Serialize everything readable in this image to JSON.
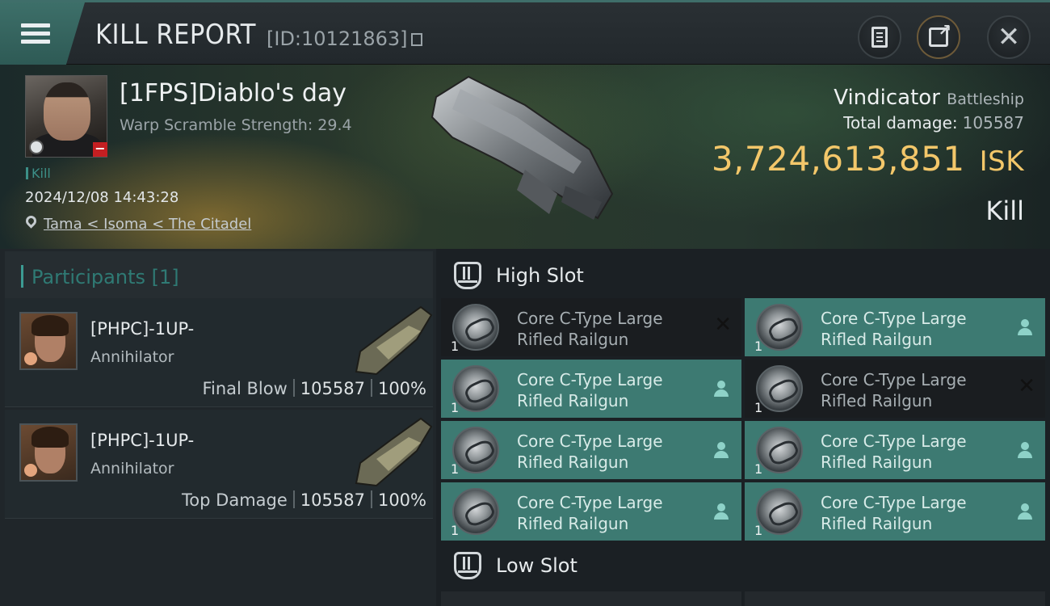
{
  "header": {
    "title": "KILL REPORT",
    "report_id": "[ID:10121863]"
  },
  "victim": {
    "name": "[1FPS]Diablo's day",
    "warp_scramble": "Warp Scramble Strength: 29.4",
    "kill_tag": "Kill",
    "datetime": "2024/12/08 14:43:28",
    "location": "Tama < Isoma < The Citadel",
    "ship_name": "Vindicator",
    "ship_class": "Battleship",
    "total_damage_label": "Total damage:",
    "total_damage": "105587",
    "isk_value": "3,724,613,851",
    "isk_unit": "ISK",
    "result": "Kill"
  },
  "participants": {
    "title": "Participants [1]",
    "items": [
      {
        "name": "[PHPC]-1UP-",
        "ship": "Annihilator",
        "label": "Final Blow",
        "damage": "105587",
        "percent": "100%"
      },
      {
        "name": "[PHPC]-1UP-",
        "ship": "Annihilator",
        "label": "Top Damage",
        "damage": "105587",
        "percent": "100%"
      }
    ]
  },
  "slots": {
    "high_title": "High Slot",
    "low_title": "Low Slot",
    "modules": [
      {
        "line1": "Core C-Type Large",
        "line2": "Rifled Railgun",
        "qty": "1",
        "status": "destroyed"
      },
      {
        "line1": "Core C-Type Large",
        "line2": "Rifled Railgun",
        "qty": "1",
        "status": "dropped"
      },
      {
        "line1": "Core C-Type Large",
        "line2": "Rifled Railgun",
        "qty": "1",
        "status": "dropped"
      },
      {
        "line1": "Core C-Type Large",
        "line2": "Rifled Railgun",
        "qty": "1",
        "status": "destroyed"
      },
      {
        "line1": "Core C-Type Large",
        "line2": "Rifled Railgun",
        "qty": "1",
        "status": "dropped"
      },
      {
        "line1": "Core C-Type Large",
        "line2": "Rifled Railgun",
        "qty": "1",
        "status": "dropped"
      },
      {
        "line1": "Core C-Type Large",
        "line2": "Rifled Railgun",
        "qty": "1",
        "status": "dropped"
      },
      {
        "line1": "Core C-Type Large",
        "line2": "Rifled Railgun",
        "qty": "1",
        "status": "dropped"
      }
    ]
  },
  "colors": {
    "accent": "#3d7a72",
    "isk": "#f3c76a",
    "destroyed": "#1a1d20"
  }
}
